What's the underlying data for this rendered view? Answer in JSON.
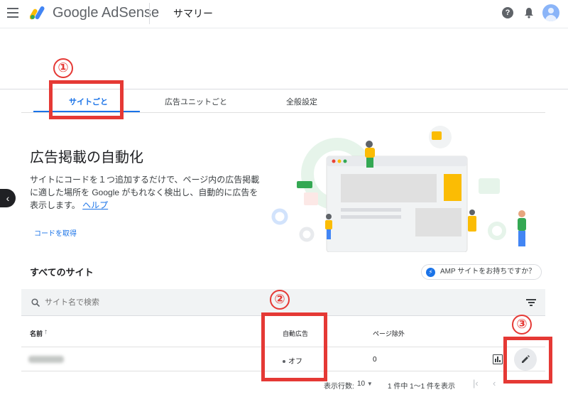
{
  "header": {
    "brand": "Google AdSense",
    "page_title": "サマリー",
    "help_glyph": "?"
  },
  "tabs": [
    {
      "label": "サイトごと",
      "active": true
    },
    {
      "label": "広告ユニットごと",
      "active": false
    },
    {
      "label": "全般設定",
      "active": false
    }
  ],
  "markers": [
    "①",
    "②",
    "③"
  ],
  "hero": {
    "title": "広告掲載の自動化",
    "description": "サイトにコードを１つ追加するだけで、ページ内の広告掲載に適した場所を Google がもれなく検出し、自動的に広告を表示します。",
    "help_link": "ヘルプ",
    "get_code": "コードを取得"
  },
  "sites": {
    "title": "すべてのサイト",
    "amp_chip": "AMP サイトをお持ちですか？",
    "search_placeholder": "サイト名で検索",
    "columns": {
      "name": "名前",
      "sort_arrow": "↑",
      "auto_ads": "自動広告",
      "page_exclusions": "ページ除外"
    },
    "rows": [
      {
        "status": "オフ",
        "page_exclusions": "0"
      }
    ]
  },
  "pagination": {
    "rows_label": "表示行数:",
    "rows_value": "10",
    "range": "1 件中 1〜1 件を表示"
  },
  "colors": {
    "accent": "#1a73e8",
    "annotation_red": "#e53935",
    "logo_yellow": "#fbbc04",
    "logo_blue": "#4285f4",
    "logo_green": "#34a853"
  }
}
